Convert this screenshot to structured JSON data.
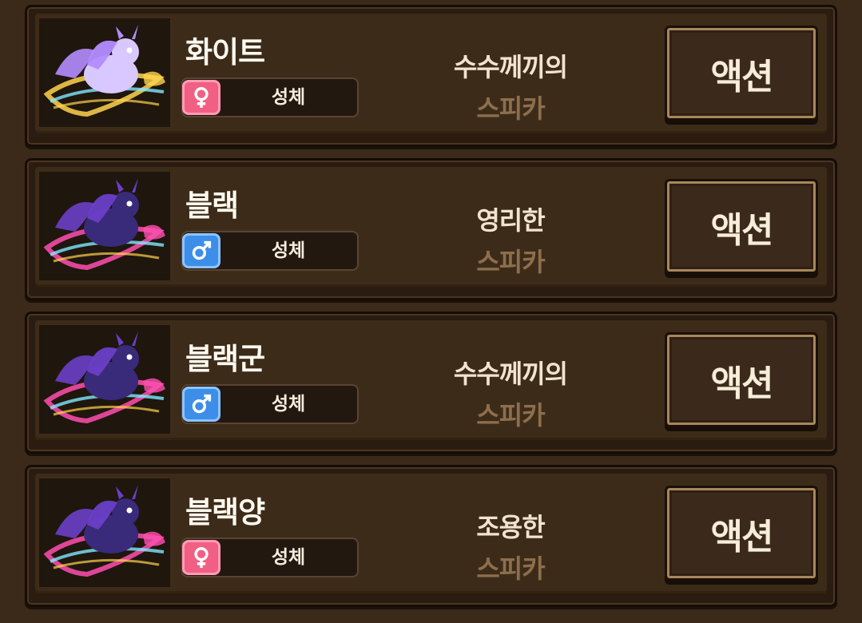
{
  "pets": [
    {
      "name": "화이트",
      "gender": "female",
      "gender_icon": "female-symbol-icon",
      "stage": "성체",
      "personality": "수수께끼의",
      "species": "스피카",
      "action_label": "액션",
      "body_color": "#d8c8ff",
      "wing_color": "#b48cff",
      "accent_color": "#ffd34d"
    },
    {
      "name": "블랙",
      "gender": "male",
      "gender_icon": "male-symbol-icon",
      "stage": "성체",
      "personality": "영리한",
      "species": "스피카",
      "action_label": "액션",
      "body_color": "#3a2a7a",
      "wing_color": "#6a3fc8",
      "accent_color": "#ff4fb0"
    },
    {
      "name": "블랙군",
      "gender": "male",
      "gender_icon": "male-symbol-icon",
      "stage": "성체",
      "personality": "수수께끼의",
      "species": "스피카",
      "action_label": "액션",
      "body_color": "#3a2a7a",
      "wing_color": "#6a3fc8",
      "accent_color": "#ff4fb0"
    },
    {
      "name": "블랙양",
      "gender": "female",
      "gender_icon": "female-symbol-icon",
      "stage": "성체",
      "personality": "조용한",
      "species": "스피카",
      "action_label": "액션",
      "body_color": "#3a2a7a",
      "wing_color": "#6a3fc8",
      "accent_color": "#ff4fb0"
    }
  ],
  "colors": {
    "background": "#3b2a1a",
    "female": "#f25f84",
    "male": "#3d8ee8",
    "species_text": "#8d6f4c"
  }
}
